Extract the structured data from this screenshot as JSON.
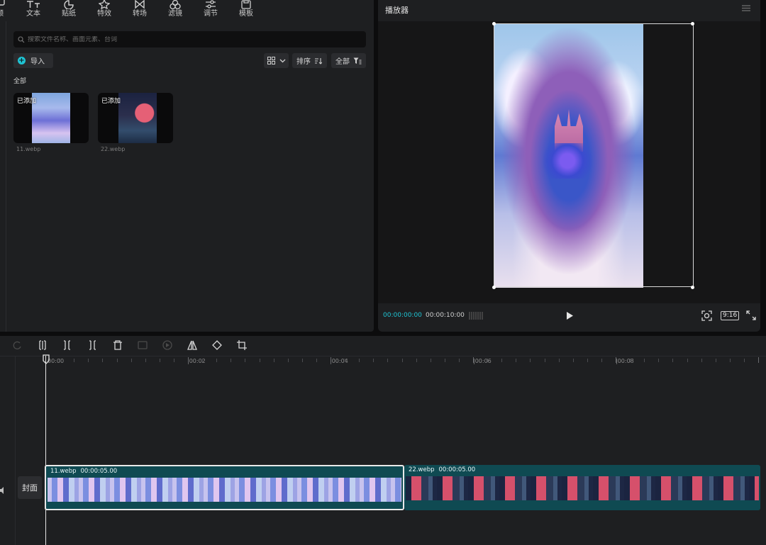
{
  "toolbar": {
    "items": [
      {
        "label": "频",
        "icon": "media-icon"
      },
      {
        "label": "文本",
        "icon": "text-icon"
      },
      {
        "label": "贴纸",
        "icon": "sticker-icon"
      },
      {
        "label": "特效",
        "icon": "effects-icon"
      },
      {
        "label": "转场",
        "icon": "transition-icon"
      },
      {
        "label": "滤镜",
        "icon": "filter-icon"
      },
      {
        "label": "调节",
        "icon": "adjust-icon"
      },
      {
        "label": "模板",
        "icon": "template-icon"
      }
    ]
  },
  "media": {
    "search_placeholder": "搜索文件名称、画面元素、台词",
    "import_label": "导入",
    "sort_label": "排序",
    "filter_label": "全部",
    "section_label": "全部",
    "items": [
      {
        "badge": "已添加",
        "filename": "11.webp"
      },
      {
        "badge": "已添加",
        "filename": "22.webp"
      }
    ]
  },
  "player": {
    "title": "播放器",
    "current_time": "00:00:00:00",
    "total_time": "00:00:10:00",
    "ratio_label": "9:16"
  },
  "timeline": {
    "ruler_labels": [
      "00:00",
      "|00:02",
      "|00:04",
      "|00:06",
      "|00:08"
    ],
    "cover_label": "封面",
    "clips": [
      {
        "name": "11.webp",
        "duration": "00:00:05.00",
        "selected": true
      },
      {
        "name": "22.webp",
        "duration": "00:00:05.00",
        "selected": false
      }
    ]
  },
  "colors": {
    "accent": "#1fc4d4",
    "clip_bg": "#0f4a52",
    "panel_bg": "#1e1f21",
    "app_bg": "#0c0c0d"
  }
}
